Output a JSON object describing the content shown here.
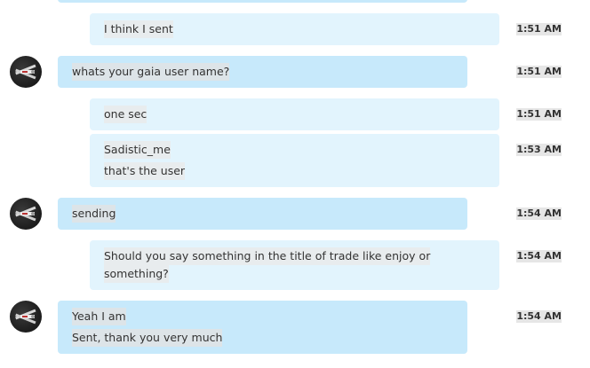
{
  "messages": [
    {
      "text": [
        ""
      ],
      "time": ""
    },
    {
      "text": [
        "I think I sent"
      ],
      "time": "1:51 AM"
    },
    {
      "text": [
        "whats your gaia user name?"
      ],
      "time": "1:51 AM"
    },
    {
      "text": [
        "one sec"
      ],
      "time": "1:51 AM"
    },
    {
      "text": [
        "Sadistic_me",
        "that's the user"
      ],
      "time": "1:53 AM"
    },
    {
      "text": [
        "sending"
      ],
      "time": "1:54 AM"
    },
    {
      "text": [
        "Should you say something in the title of trade like enjoy or",
        "something?"
      ],
      "time": "1:54 AM"
    },
    {
      "text": [
        "Yeah I am",
        "Sent, thank you very much"
      ],
      "time": "1:54 AM"
    }
  ],
  "colors": {
    "incoming_bubble": "#c7e9fb",
    "outgoing_bubble": "#e2f4fd",
    "text": "#333333"
  },
  "icons": {
    "avatar": "x-wing-fighter-avatar"
  }
}
